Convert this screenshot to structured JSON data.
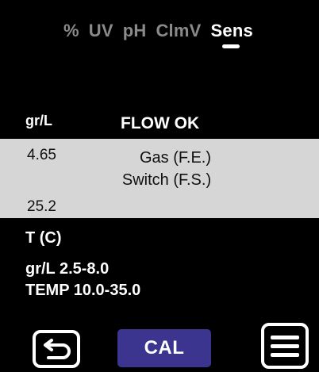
{
  "tabs": [
    {
      "label": "%",
      "active": false
    },
    {
      "label": "UV",
      "active": false
    },
    {
      "label": "pH",
      "active": false
    },
    {
      "label": "ClmV",
      "active": false
    },
    {
      "label": "Sens",
      "active": true
    }
  ],
  "readout": {
    "unit_label": "gr/L",
    "flow_status": "FLOW OK",
    "value_top": "4.65",
    "value_bottom": "25.2",
    "switch_line1": "Gas (F.E.)",
    "switch_line2": "Switch (F.S.)",
    "temp_label": "T (C)",
    "range_gr": "gr/L 2.5-8.0",
    "range_temp": "TEMP 10.0-35.0"
  },
  "buttons": {
    "back_icon": "back-arrow-icon",
    "cal_label": "CAL",
    "menu_icon": "hamburger-menu-icon"
  },
  "colors": {
    "background": "#000000",
    "band": "#d6d6d6",
    "cal_button": "#3b3590",
    "inactive_tab": "#8a8a8a"
  }
}
